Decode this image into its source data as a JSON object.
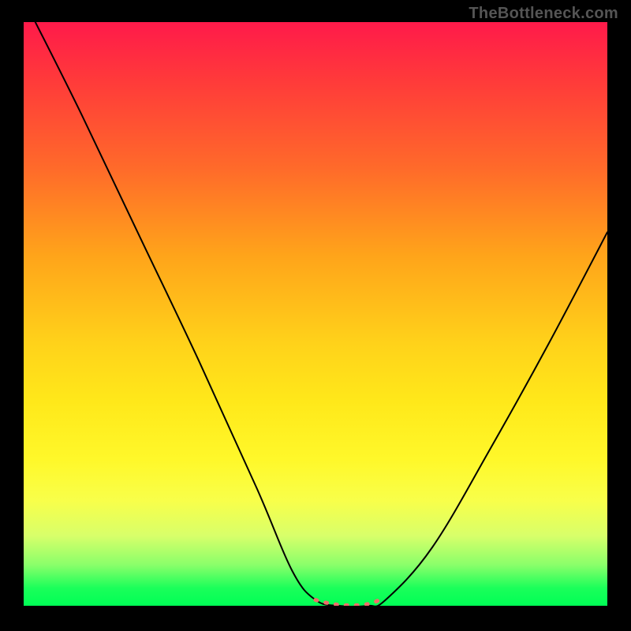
{
  "watermark": "TheBottleneck.com",
  "chart_data": {
    "type": "line",
    "title": "",
    "xlabel": "",
    "ylabel": "",
    "xlim": [
      0,
      1
    ],
    "ylim": [
      0,
      1
    ],
    "series": [
      {
        "name": "curve",
        "x": [
          0.02,
          0.1,
          0.2,
          0.3,
          0.4,
          0.46,
          0.5,
          0.54,
          0.59,
          0.62,
          0.7,
          0.8,
          0.9,
          1.0
        ],
        "values": [
          1.0,
          0.84,
          0.63,
          0.42,
          0.2,
          0.06,
          0.01,
          0.0,
          0.0,
          0.01,
          0.1,
          0.27,
          0.45,
          0.64
        ]
      },
      {
        "name": "valley-marker",
        "x": [
          0.5,
          0.515,
          0.53,
          0.545,
          0.56,
          0.575,
          0.59,
          0.6,
          0.61
        ],
        "values": [
          0.01,
          0.006,
          0.003,
          0.001,
          0.001,
          0.001,
          0.003,
          0.006,
          0.01
        ]
      }
    ],
    "legend": [],
    "grid": false,
    "background_gradient": {
      "top": "#ff1a4a",
      "bottom": "#00ff55"
    }
  }
}
